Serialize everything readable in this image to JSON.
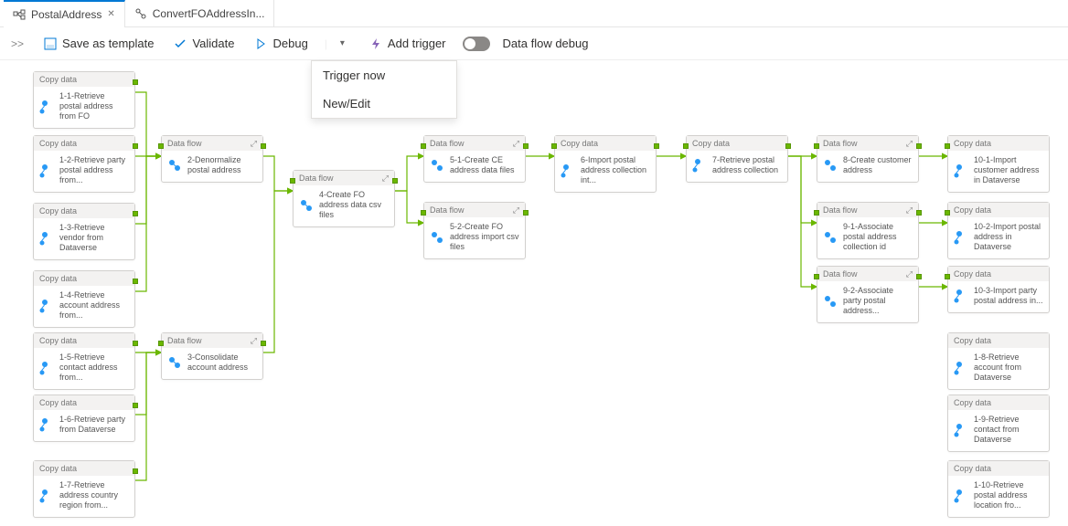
{
  "tabs": {
    "active": "PostalAddress",
    "secondary": "ConvertFOAddressIn..."
  },
  "toolbar": {
    "expand": ">>",
    "save_template": "Save as template",
    "validate": "Validate",
    "debug": "Debug",
    "add_trigger": "Add trigger",
    "debug_toggle": "Data flow debug"
  },
  "dropdown": {
    "item1": "Trigger now",
    "item2": "New/Edit"
  },
  "node_types": {
    "copy": "Copy data",
    "flow": "Data flow"
  },
  "nodes": {
    "n11": "1-1-Retrieve postal address from FO",
    "n12": "1-2-Retrieve party postal address from...",
    "n13": "1-3-Retrieve vendor from Dataverse",
    "n14": "1-4-Retrieve account address from...",
    "n15": "1-5-Retrieve contact address from...",
    "n16": "1-6-Retrieve party from Dataverse",
    "n17": "1-7-Retrieve address country region from...",
    "n2": "2-Denormalize postal address",
    "n3": "3-Consolidate account address",
    "n4": "4-Create FO address data csv files",
    "n51": "5-1-Create CE address data files",
    "n52": "5-2-Create FO address import csv files",
    "n6": "6-Import postal address collection int...",
    "n7": "7-Retrieve postal address collection",
    "n8": "8-Create customer address",
    "n91": "9-1-Associate postal address collection id",
    "n92": "9-2-Associate party postal address...",
    "n101": "10-1-Import customer address in Dataverse",
    "n102": "10-2-Import postal address in Dataverse",
    "n103": "10-3-Import party postal address in...",
    "n108": "1-8-Retrieve account from Dataverse",
    "n109": "1-9-Retrieve contact from Dataverse",
    "n110": "1-10-Retrieve postal address location fro..."
  }
}
